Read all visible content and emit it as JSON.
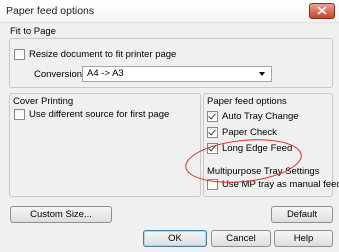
{
  "window": {
    "title": "Paper feed options"
  },
  "fit_to_page": {
    "group_label": "Fit to Page",
    "resize_label": "Resize document to fit printer page",
    "resize_checked": false,
    "conversion_label": "Conversion:",
    "conversion_value": "A4 -> A3"
  },
  "cover_printing": {
    "group_label": "Cover Printing",
    "different_source_label": "Use different source for first page",
    "different_source_checked": false
  },
  "paper_feed_options": {
    "group_label": "Paper feed options",
    "items": [
      {
        "label": "Auto Tray Change",
        "checked": true
      },
      {
        "label": "Paper Check",
        "checked": true
      },
      {
        "label": "Long Edge Feed",
        "checked": true
      }
    ]
  },
  "multipurpose_tray": {
    "group_label": "Multipurpose Tray Settings",
    "mp_manual_label": "Use MP tray as manual feed",
    "mp_manual_checked": false
  },
  "buttons": {
    "custom_size": "Custom Size...",
    "default": "Default",
    "ok": "OK",
    "cancel": "Cancel",
    "help": "Help"
  },
  "colors": {
    "highlight_oval": "#e0282a",
    "close_button": "#c9452a"
  }
}
